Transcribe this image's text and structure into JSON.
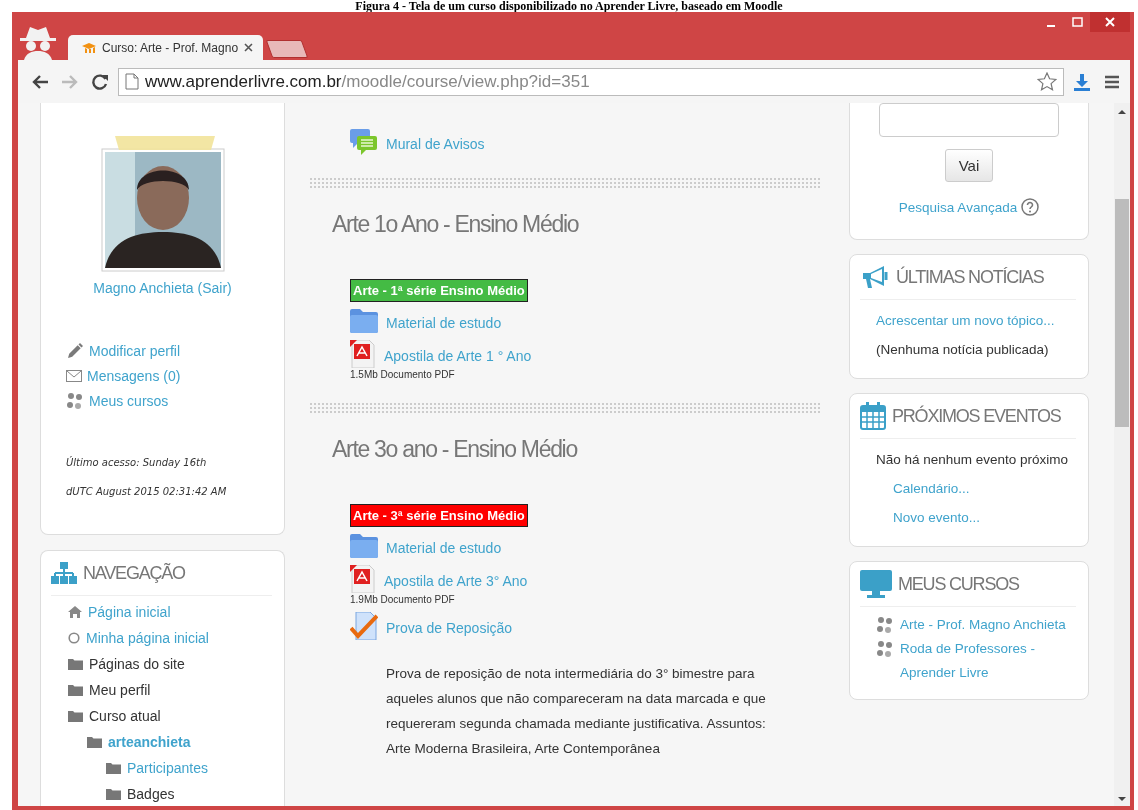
{
  "caption": "Figura 4 - Tela de um curso disponibilizado no Aprender Livre, baseado em Moodle",
  "browser": {
    "tabs": [
      {
        "title": "Curso: Arte - Prof. Magno",
        "selected": true
      }
    ],
    "address": {
      "host": "www.aprenderlivre.com.br",
      "path": "/moodle/course/view.php?id=351"
    },
    "forward_disabled": true
  },
  "user_block": {
    "name": "Magno Anchieta",
    "logout": "(Sair)",
    "links": [
      {
        "label": "Modificar perfil",
        "kind": "pencil"
      },
      {
        "label": "Mensagens (0)",
        "kind": "envelope"
      },
      {
        "label": "Meus cursos",
        "kind": "courses"
      }
    ],
    "last_access": "Último acesso: Sunday 16th dUTC August 2015 02:31:42 AM"
  },
  "navigation": {
    "title": "NAVEGAÇÃO",
    "items": [
      {
        "label": "Página inicial",
        "kind": "home",
        "link": true,
        "selected": false
      },
      {
        "label": "Minha página inicial",
        "kind": "circle",
        "link": true,
        "selected": false
      },
      {
        "label": "Páginas do site",
        "kind": "folder",
        "link": false,
        "selected": false
      },
      {
        "label": "Meu perfil",
        "kind": "folder",
        "link": false,
        "selected": false
      },
      {
        "label": "Curso atual",
        "kind": "folder",
        "link": false,
        "selected": false,
        "children": [
          {
            "label": "arteanchieta",
            "kind": "folder",
            "link": true,
            "selected": true,
            "children": [
              {
                "label": "Participantes",
                "kind": "folder",
                "link": true,
                "selected": false
              },
              {
                "label": "Badges",
                "kind": "folder",
                "link": false,
                "selected": false
              }
            ]
          }
        ]
      }
    ]
  },
  "course": {
    "top_item": {
      "label": "Mural de Avisos",
      "kind": "forum"
    },
    "sections": [
      {
        "title": "Arte 1o Ano - Ensino Médio",
        "banner": {
          "text": "Arte - 1ª série Ensino Médio",
          "color": "#44bb44"
        },
        "activities": [
          {
            "label": "Material de estudo",
            "kind": "folder"
          },
          {
            "label": "Apostila de Arte 1 ° Ano",
            "kind": "pdf",
            "details": "1.5Mb Documento PDF"
          }
        ]
      },
      {
        "title": "Arte 3o ano - Ensino Médio",
        "banner": {
          "text": "Arte - 3ª série Ensino Médio",
          "color": "#ff0000"
        },
        "activities": [
          {
            "label": "Material de estudo",
            "kind": "folder"
          },
          {
            "label": "Apostila de Arte 3° Ano",
            "kind": "pdf",
            "details": "1.9Mb Documento PDF"
          },
          {
            "label": "Prova de Reposição",
            "kind": "quiz",
            "description": "Prova de reposição de nota intermediária do 3° bimestre para aqueles alunos que não compareceram na data marcada e que requereram segunda chamada mediante justificativa. Assuntos: Arte Moderna Brasileira, Arte Contemporânea"
          }
        ]
      }
    ]
  },
  "search_block": {
    "button": "Vai",
    "advanced": "Pesquisa Avançada"
  },
  "side_blocks": [
    {
      "title": "ÚLTIMAS NOTÍCIAS",
      "kind": "megaphone",
      "lines": [
        {
          "text": "Acrescentar um novo tópico...",
          "kind": "link"
        },
        {
          "text": "(Nenhuma notícia publicada)",
          "kind": "text"
        }
      ]
    },
    {
      "title": "PRÓXIMOS EVENTOS",
      "kind": "calendar",
      "lines": [
        {
          "text": "Não há nenhum evento próximo",
          "kind": "text"
        },
        {
          "text": "Calendário...",
          "kind": "sublink"
        },
        {
          "text": "Novo evento...",
          "kind": "sublink"
        }
      ]
    },
    {
      "title": "MEUS CURSOS",
      "kind": "monitor",
      "lines": [
        {
          "text": "Arte - Prof. Magno Anchieta",
          "kind": "course"
        },
        {
          "text": "Roda de Professores - Aprender Livre",
          "kind": "course"
        }
      ]
    }
  ]
}
